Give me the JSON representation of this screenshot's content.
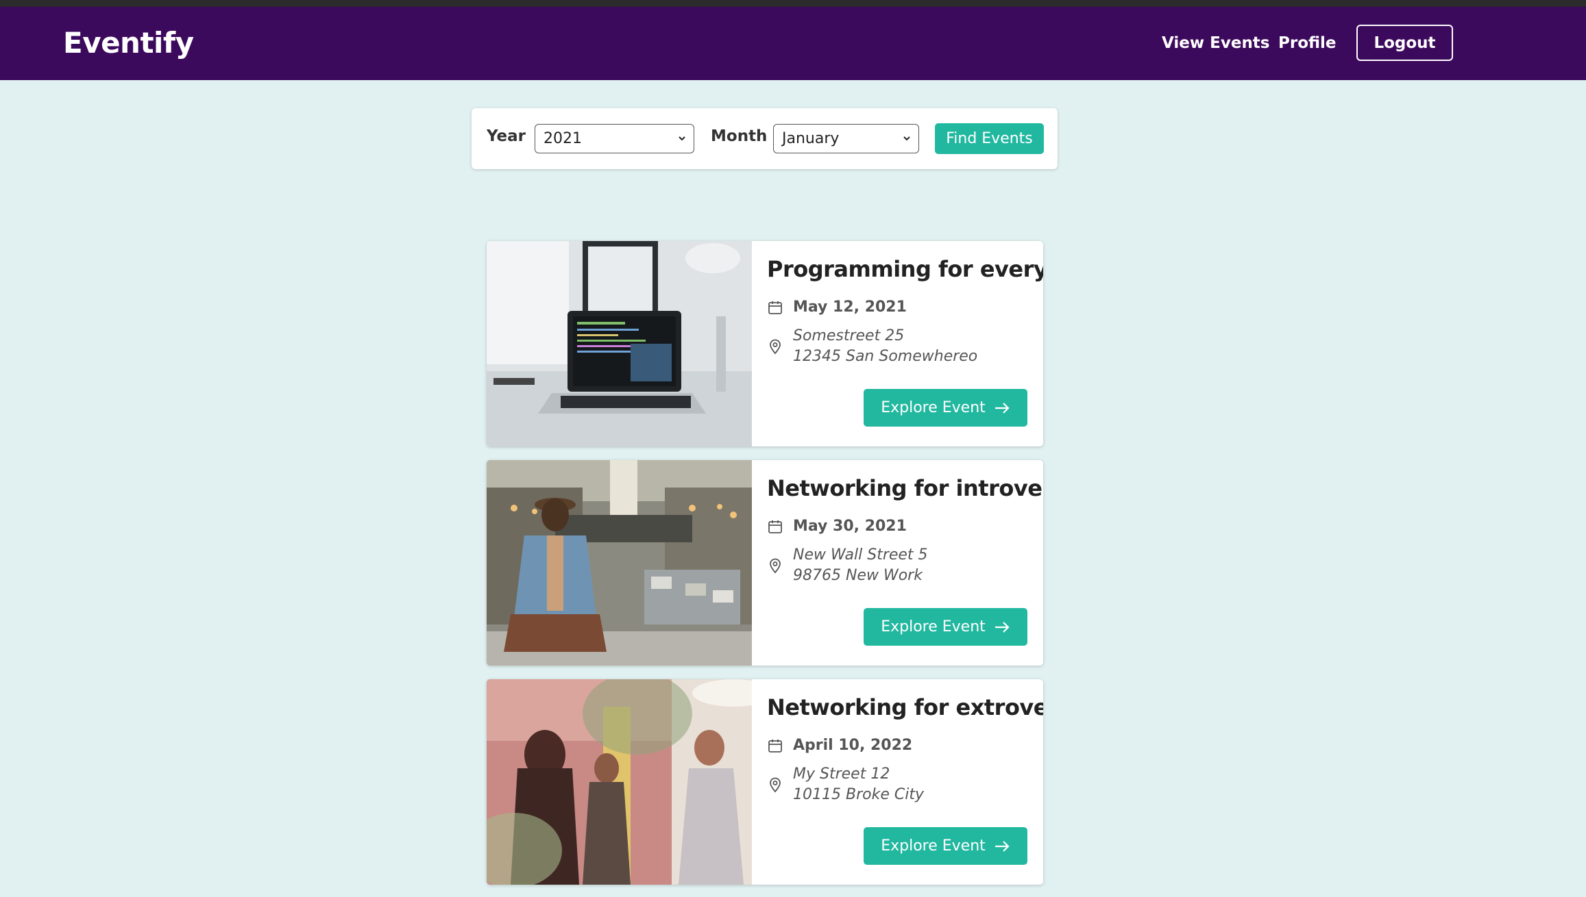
{
  "app": {
    "brand": "Eventify"
  },
  "nav": {
    "view_events": "View Events",
    "profile": "Profile",
    "logout": "Logout"
  },
  "filter": {
    "year_label": "Year",
    "year_value": "2021",
    "month_label": "Month",
    "month_value": "January",
    "find_button": "Find Events"
  },
  "colors": {
    "navbar": "#3c0a5c",
    "accent": "#22b8a0",
    "background": "#e1f0f0"
  },
  "events": [
    {
      "title": "Programming for everyone",
      "date": "May 12, 2021",
      "address_line1": "Somestreet 25",
      "address_line2": "12345 San Somewhereo",
      "button": "Explore Event",
      "image": "laptop-on-desk-photo"
    },
    {
      "title": "Networking for introverts",
      "date": "May 30, 2021",
      "address_line1": "New Wall Street 5",
      "address_line2": "98765 New Work",
      "button": "Explore Event",
      "image": "man-sitting-city-street-photo"
    },
    {
      "title": "Networking for extroverts",
      "date": "April 10, 2022",
      "address_line1": "My Street 12",
      "address_line2": "10115 Broke City",
      "button": "Explore Event",
      "image": "people-talking-office-photo"
    }
  ]
}
